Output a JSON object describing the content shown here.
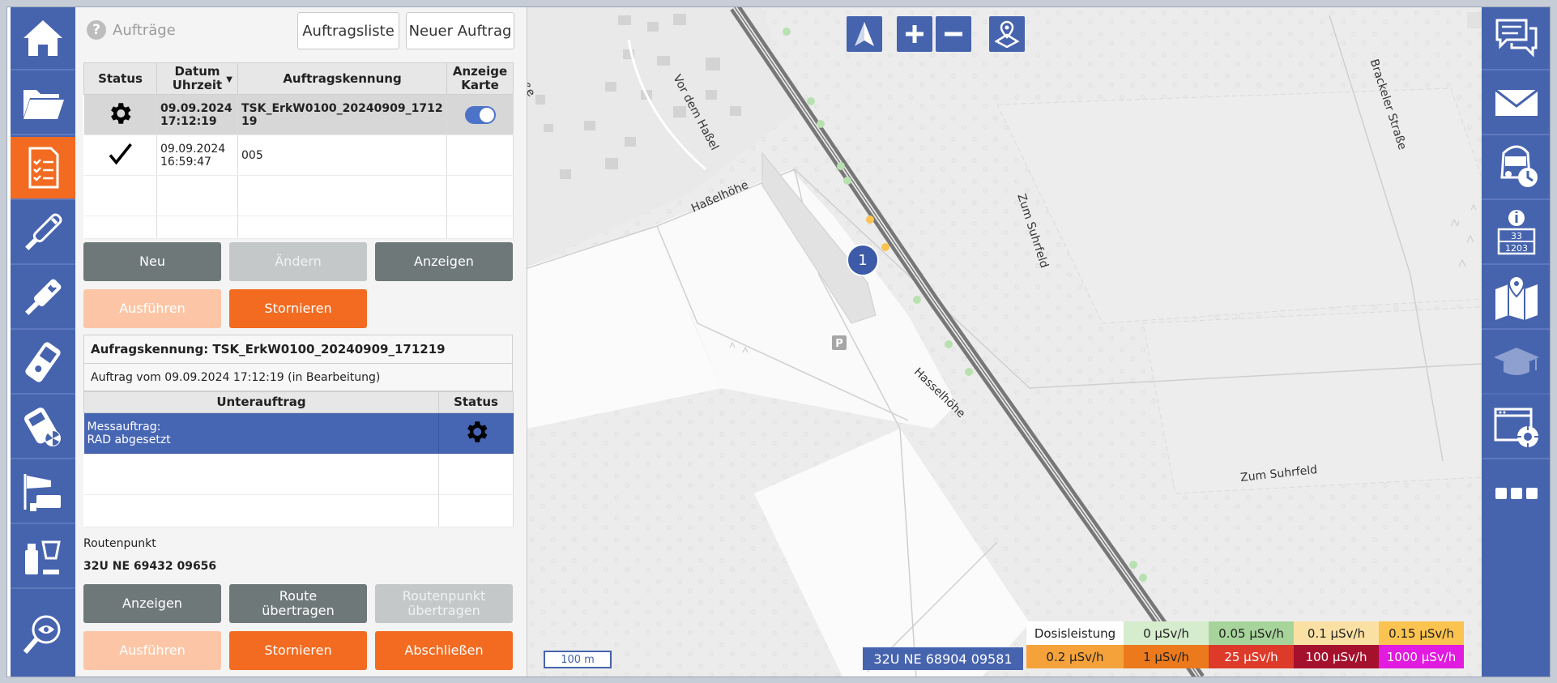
{
  "panel": {
    "title": "Aufträge",
    "tabs": [
      "Auftragsliste",
      "Neuer Auftrag"
    ]
  },
  "orders_table": {
    "headers": {
      "status": "Status",
      "date": "Datum\nUhrzeit",
      "id": "Auftragskennung",
      "map": "Anzeige Karte"
    },
    "header_date_line1": "Datum",
    "header_date_line2": "Uhrzeit",
    "header_map_line1": "Anzeige",
    "header_map_line2": "Karte",
    "rows": [
      {
        "status_icon": "gear-icon",
        "date": "09.09.2024",
        "time": "17:12:19",
        "id": "TSK_ErkW0100_20240909_171219",
        "map_toggle": "on"
      },
      {
        "status_icon": "checkmark-icon",
        "date": "09.09.2024",
        "time": "16:59:47",
        "id": "005",
        "map_toggle": "none"
      }
    ]
  },
  "order_buttons": {
    "new": "Neu",
    "edit": "Ändern",
    "show": "Anzeigen",
    "execute": "Ausführen",
    "cancel": "Stornieren"
  },
  "details": {
    "id_label": "Aufragskennung: TSK_ErkW0100_20240909_171219",
    "order_info": "Auftrag vom 09.09.2024 17:12:19 (in Bearbeitung)"
  },
  "suborders_table": {
    "headers": {
      "suborder": "Unterauftrag",
      "status": "Status"
    },
    "rows": [
      {
        "line1": "Messauftrag:",
        "line2": "RAD abgesetzt",
        "status_icon": "gear-icon"
      }
    ]
  },
  "route": {
    "label": "Routenpunkt",
    "value": "32U NE 69432 09656"
  },
  "route_buttons": {
    "show": "Anzeigen",
    "route_transfer_1": "Route",
    "route_transfer_2": "übertragen",
    "point_transfer_1": "Routenpunkt",
    "point_transfer_2": "übertragen",
    "execute": "Ausführen",
    "cancel": "Stornieren",
    "complete": "Abschließen"
  },
  "map": {
    "marker_label": "1",
    "scale": "100 m",
    "coordinate": "32U NE 68904 09581",
    "streets": [
      "Haßelhöhe",
      "Vor dem Haßel",
      "Hasselhöhe",
      "Zum Suhrfeld",
      "Zum Suhrfeld",
      "Brackeler Straße",
      "ße"
    ],
    "parking": "P"
  },
  "legend": {
    "title": "Dosisleistung",
    "items": [
      {
        "label": "0 µSv/h",
        "color": "#d5eccd"
      },
      {
        "label": "0.05 µSv/h",
        "color": "#a7d49b"
      },
      {
        "label": "0.1 µSv/h",
        "color": "#fbe0a4"
      },
      {
        "label": "0.15 µSv/h",
        "color": "#fbc34f"
      },
      {
        "label": "0.2 µSv/h",
        "color": "#f6a23a"
      },
      {
        "label": "1 µSv/h",
        "color": "#ec7a1d"
      },
      {
        "label": "25 µSv/h",
        "color": "#dd3a2a"
      },
      {
        "label": "100 µSv/h",
        "color": "#a5102c"
      },
      {
        "label": "1000 µSv/h",
        "color": "#e11be0"
      }
    ]
  },
  "icons": {
    "left": [
      "home-icon",
      "folder-icon",
      "checklist-icon",
      "probe-icon",
      "dosimeter-probe-icon",
      "handheld-device-icon",
      "radiation-meter-icon",
      "weather-sensor-icon",
      "sample-icon",
      "inspection-icon"
    ],
    "right": [
      "chat-icon",
      "mail-icon",
      "vehicle-timer-icon",
      "info-counter-icon",
      "map-pin-icon",
      "training-icon",
      "settings-window-icon",
      "more-icon"
    ]
  },
  "colors": {
    "nav": "#4663ae",
    "accent": "#f26b21"
  }
}
